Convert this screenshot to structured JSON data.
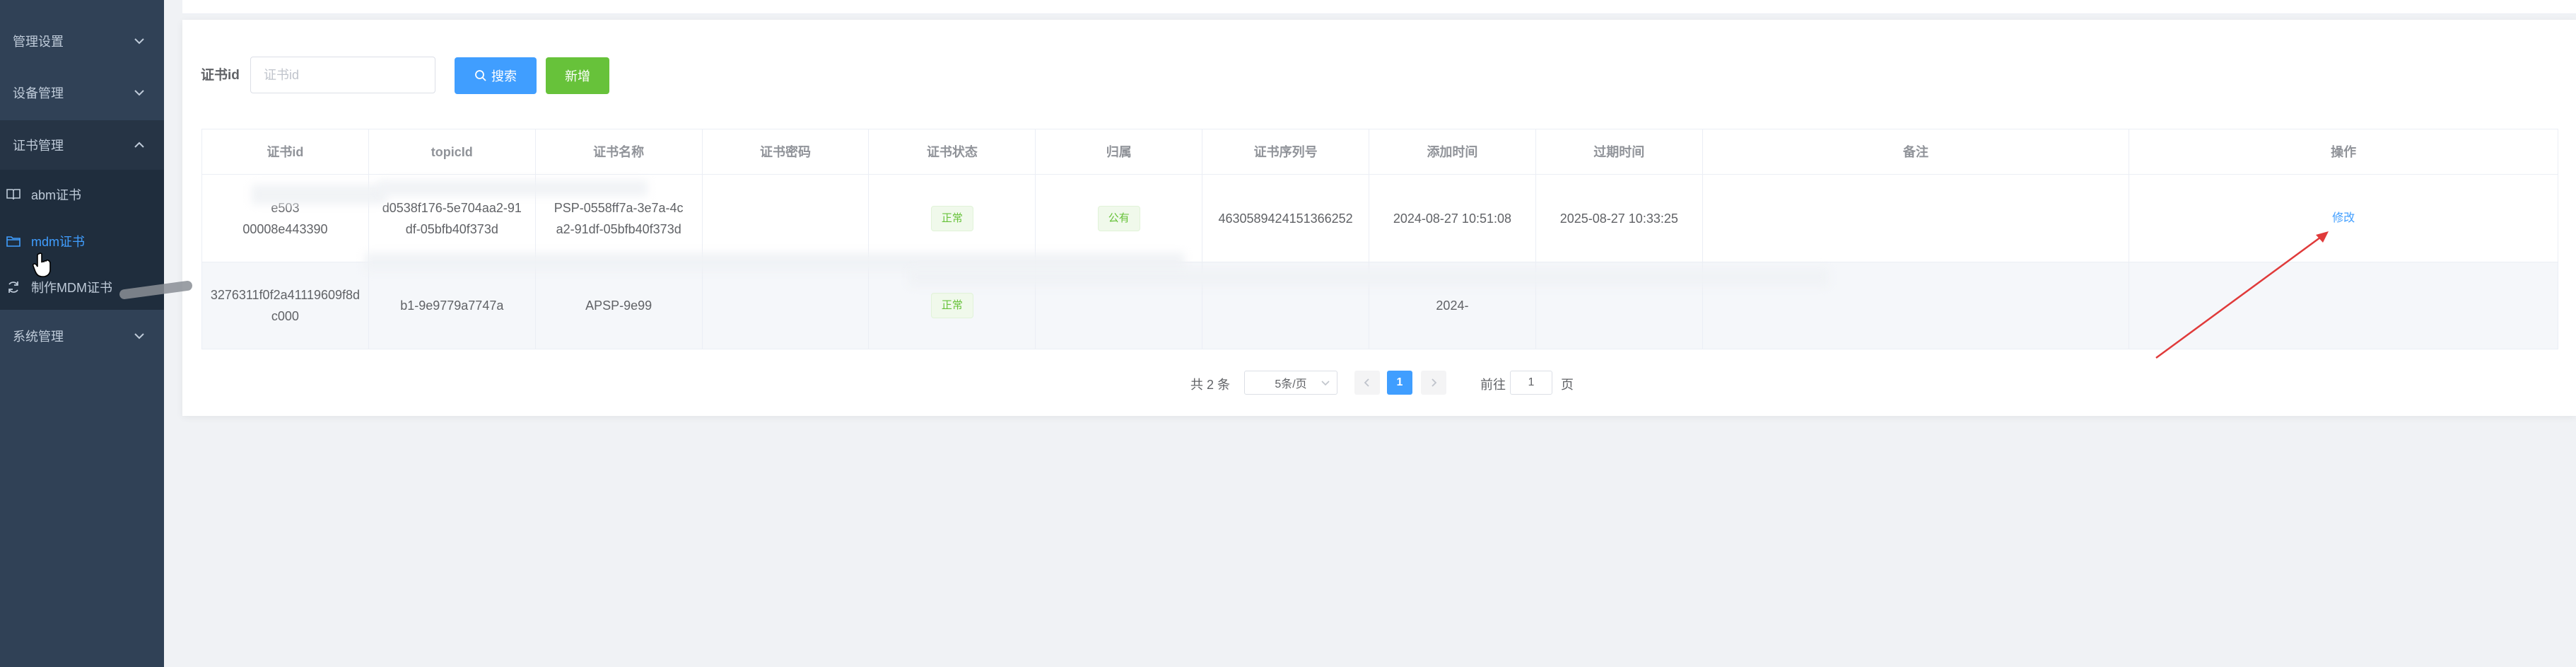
{
  "sidebar": {
    "items": [
      {
        "label": "管理设置"
      },
      {
        "label": "设备管理"
      },
      {
        "label": "证书管理"
      },
      {
        "label": "系统管理"
      }
    ],
    "submenu": [
      {
        "label": "abm证书",
        "icon": "book-icon"
      },
      {
        "label": "mdm证书",
        "icon": "folder-icon"
      },
      {
        "label": "制作MDM证书",
        "icon": "refresh-icon"
      }
    ]
  },
  "filter": {
    "label": "证书id",
    "placeholder": "证书id",
    "search_label": "搜索",
    "add_label": "新增"
  },
  "table": {
    "headers": [
      "证书id",
      "topicId",
      "证书名称",
      "证书密码",
      "证书状态",
      "归属",
      "证书序列号",
      "添加时间",
      "过期时间",
      "备注",
      "操作"
    ],
    "rows": [
      {
        "id_line1": "e503",
        "id_line2": "00008e443390",
        "topic_line1": "d0538f176-5e704aa2-91",
        "topic_line2": "df-05bfb40f373d",
        "name_line1": "PSP-0558ff7a-3e7a-4c",
        "name_line2": "a2-91df-05bfb40f373d",
        "password": "",
        "status": "正常",
        "owner": "公有",
        "serial": "4630589424151366252",
        "added": "2024-08-27 10:51:08",
        "expires": "2025-08-27 10:33:25",
        "remark": "",
        "op": "修改"
      },
      {
        "id_line1": "3276311f0f2a41119609f8d",
        "id_line2": "c000",
        "topic_line1": "",
        "topic_line2": "b1-9e9779a7747a",
        "name_line1": "APSP-9e99",
        "name_line2": "",
        "password": "",
        "status": "正常",
        "owner": "",
        "serial": "",
        "added": "2024-",
        "expires": "",
        "remark": "",
        "op": ""
      }
    ]
  },
  "pagination": {
    "total": "共 2 条",
    "page_size": "5条/页",
    "current": "1",
    "jump_label": "前往",
    "jump_value": "1",
    "jump_suffix": "页"
  },
  "colors": {
    "sidebar_bg": "#304156",
    "primary": "#409eff",
    "success": "#67c23a",
    "annotation": "#e03a3a"
  }
}
